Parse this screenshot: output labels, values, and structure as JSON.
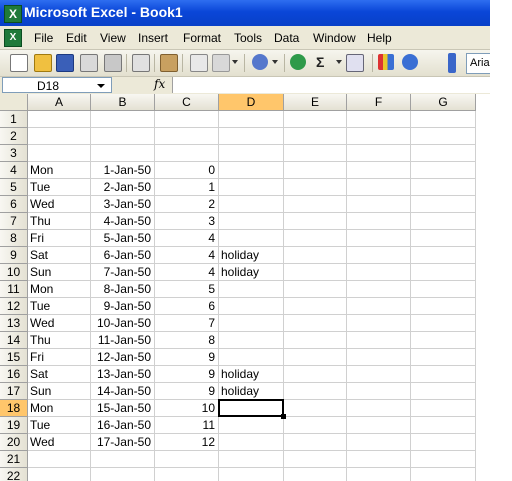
{
  "window": {
    "title": "Microsoft Excel - Book1"
  },
  "menu": [
    "File",
    "Edit",
    "View",
    "Insert",
    "Format",
    "Tools",
    "Data",
    "Window",
    "Help"
  ],
  "toolbar": {
    "sum_symbol": "Σ",
    "font_name": "Arial"
  },
  "formula_bar": {
    "name_box": "D18",
    "fx_label": "fx",
    "formula": ""
  },
  "columns": [
    "A",
    "B",
    "C",
    "D",
    "E",
    "F",
    "G"
  ],
  "selected": {
    "row": "18",
    "column": "D"
  },
  "rows": [
    {
      "num": "1",
      "a": "",
      "b": "",
      "c": "",
      "d": ""
    },
    {
      "num": "2",
      "a": "",
      "b": "",
      "c": "",
      "d": ""
    },
    {
      "num": "3",
      "a": "",
      "b": "",
      "c": "",
      "d": ""
    },
    {
      "num": "4",
      "a": "Mon",
      "b": "1-Jan-50",
      "c": "0",
      "d": ""
    },
    {
      "num": "5",
      "a": "Tue",
      "b": "2-Jan-50",
      "c": "1",
      "d": ""
    },
    {
      "num": "6",
      "a": "Wed",
      "b": "3-Jan-50",
      "c": "2",
      "d": ""
    },
    {
      "num": "7",
      "a": "Thu",
      "b": "4-Jan-50",
      "c": "3",
      "d": ""
    },
    {
      "num": "8",
      "a": "Fri",
      "b": "5-Jan-50",
      "c": "4",
      "d": ""
    },
    {
      "num": "9",
      "a": "Sat",
      "b": "6-Jan-50",
      "c": "4",
      "d": "holiday"
    },
    {
      "num": "10",
      "a": "Sun",
      "b": "7-Jan-50",
      "c": "4",
      "d": "holiday"
    },
    {
      "num": "11",
      "a": "Mon",
      "b": "8-Jan-50",
      "c": "5",
      "d": ""
    },
    {
      "num": "12",
      "a": "Tue",
      "b": "9-Jan-50",
      "c": "6",
      "d": ""
    },
    {
      "num": "13",
      "a": "Wed",
      "b": "10-Jan-50",
      "c": "7",
      "d": ""
    },
    {
      "num": "14",
      "a": "Thu",
      "b": "11-Jan-50",
      "c": "8",
      "d": ""
    },
    {
      "num": "15",
      "a": "Fri",
      "b": "12-Jan-50",
      "c": "9",
      "d": ""
    },
    {
      "num": "16",
      "a": "Sat",
      "b": "13-Jan-50",
      "c": "9",
      "d": "holiday"
    },
    {
      "num": "17",
      "a": "Sun",
      "b": "14-Jan-50",
      "c": "9",
      "d": "holiday"
    },
    {
      "num": "18",
      "a": "Mon",
      "b": "15-Jan-50",
      "c": "10",
      "d": ""
    },
    {
      "num": "19",
      "a": "Tue",
      "b": "16-Jan-50",
      "c": "11",
      "d": ""
    },
    {
      "num": "20",
      "a": "Wed",
      "b": "17-Jan-50",
      "c": "12",
      "d": ""
    },
    {
      "num": "21",
      "a": "",
      "b": "",
      "c": "",
      "d": ""
    },
    {
      "num": "22",
      "a": "",
      "b": "",
      "c": "",
      "d": ""
    }
  ],
  "colors": {
    "title_bar": "#0a46d8",
    "selection_header": "#ffc66b",
    "chrome": "#ece9d8"
  }
}
